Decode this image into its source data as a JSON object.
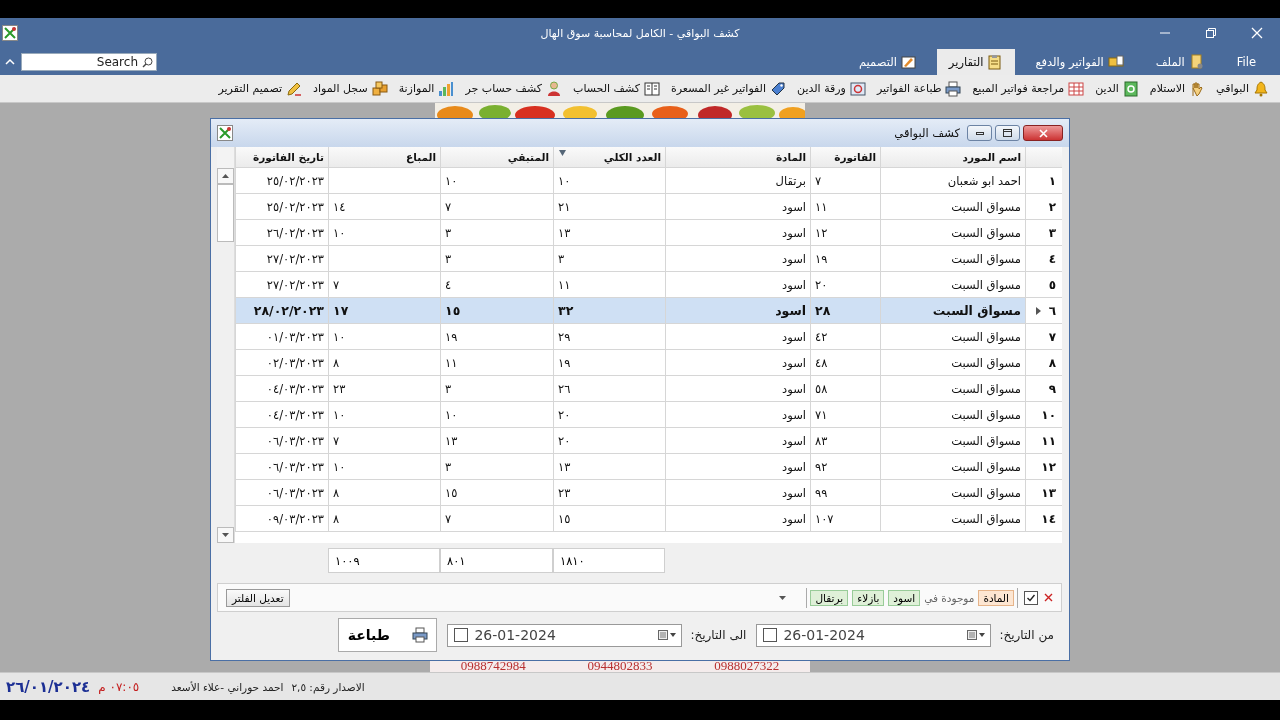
{
  "window": {
    "title": "كشف البواقي - الكامل لمحاسبة سوق الهال"
  },
  "ribbon": {
    "search": {
      "placeholder": "Search"
    },
    "tabs": [
      {
        "label": "File",
        "selected": false
      },
      {
        "label": "الملف",
        "selected": false
      },
      {
        "label": "الفواتير والدفع",
        "selected": false
      },
      {
        "label": "التقارير",
        "selected": true
      },
      {
        "label": "التصميم",
        "selected": false
      }
    ]
  },
  "toolbar": [
    "البواقي",
    "الاستلام",
    "الدين",
    "مراجعة فواتير المبيع",
    "طباعة الفواتير",
    "ورقة الدين",
    "الفواتير غير المسعرة",
    "كشف الحساب",
    "كشف حساب جر",
    "الموازنة",
    "سجل المواد",
    "تصميم التقرير"
  ],
  "background": {
    "phones": [
      "0988027322",
      "0944802833",
      "0988742984"
    ]
  },
  "report": {
    "title": "كشف البواقي",
    "columns": [
      {
        "label": "اسم المورد",
        "kind": "text",
        "filtered": false
      },
      {
        "label": "الفاتورة",
        "kind": "number",
        "filtered": false
      },
      {
        "label": "المادة",
        "kind": "text",
        "filtered": false
      },
      {
        "label": "العدد الكلي",
        "kind": "number",
        "filtered": true,
        "total": "١٨١٠"
      },
      {
        "label": "المتبقي",
        "kind": "number",
        "filtered": false,
        "total": "٨٠١"
      },
      {
        "label": "المباع",
        "kind": "number",
        "filtered": false,
        "total": "١٠٠٩"
      },
      {
        "label": "تاريخ الفاتورة",
        "kind": "date",
        "filtered": false
      }
    ],
    "rows": [
      {
        "number": "١",
        "selected": false,
        "cells": [
          "احمد ابو شعبان",
          "٧",
          "برتقال",
          "١٠",
          "١٠",
          null,
          "٢٥/٠٢/٢٠٢٣"
        ]
      },
      {
        "number": "٢",
        "selected": false,
        "cells": [
          "مسواق السبت",
          "١١",
          "اسود",
          "٢١",
          "٧",
          "١٤",
          "٢٥/٠٢/٢٠٢٣"
        ]
      },
      {
        "number": "٣",
        "selected": false,
        "cells": [
          "مسواق السبت",
          "١٢",
          "اسود",
          "١٣",
          "٣",
          "١٠",
          "٢٦/٠٢/٢٠٢٣"
        ]
      },
      {
        "number": "٤",
        "selected": false,
        "cells": [
          "مسواق السبت",
          "١٩",
          "اسود",
          "٣",
          "٣",
          null,
          "٢٧/٠٢/٢٠٢٣"
        ]
      },
      {
        "number": "٥",
        "selected": false,
        "cells": [
          "مسواق السبت",
          "٢٠",
          "اسود",
          "١١",
          "٤",
          "٧",
          "٢٧/٠٢/٢٠٢٣"
        ]
      },
      {
        "number": "٦",
        "selected": true,
        "cells": [
          "مسواق السبت",
          "٢٨",
          "اسود",
          "٣٢",
          "١٥",
          "١٧",
          "٢٨/٠٢/٢٠٢٣"
        ]
      },
      {
        "number": "٧",
        "selected": false,
        "cells": [
          "مسواق السبت",
          "٤٢",
          "اسود",
          "٢٩",
          "١٩",
          "١٠",
          "٠١/٠٣/٢٠٢٣"
        ]
      },
      {
        "number": "٨",
        "selected": false,
        "cells": [
          "مسواق السبت",
          "٤٨",
          "اسود",
          "١٩",
          "١١",
          "٨",
          "٠٢/٠٣/٢٠٢٣"
        ]
      },
      {
        "number": "٩",
        "selected": false,
        "cells": [
          "مسواق السبت",
          "٥٨",
          "اسود",
          "٢٦",
          "٣",
          "٢٣",
          "٠٤/٠٣/٢٠٢٣"
        ]
      },
      {
        "number": "١٠",
        "selected": false,
        "cells": [
          "مسواق السبت",
          "٧١",
          "اسود",
          "٢٠",
          "١٠",
          "١٠",
          "٠٤/٠٣/٢٠٢٣"
        ]
      },
      {
        "number": "١١",
        "selected": false,
        "cells": [
          "مسواق السبت",
          "٨٣",
          "اسود",
          "٢٠",
          "١٣",
          "٧",
          "٠٦/٠٣/٢٠٢٣"
        ]
      },
      {
        "number": "١٢",
        "selected": false,
        "cells": [
          "مسواق السبت",
          "٩٢",
          "اسود",
          "١٣",
          "٣",
          "١٠",
          "٠٦/٠٣/٢٠٢٣"
        ]
      },
      {
        "number": "١٣",
        "selected": false,
        "cells": [
          "مسواق السبت",
          "٩٩",
          "اسود",
          "٢٣",
          "١٥",
          "٨",
          "٠٦/٠٣/٢٠٢٣"
        ]
      },
      {
        "number": "١٤",
        "selected": false,
        "cells": [
          "مسواق السبت",
          "١٠٧",
          "اسود",
          "١٥",
          "٧",
          "٨",
          "٠٩/٠٣/٢٠٢٣"
        ]
      }
    ],
    "filter": {
      "enabled": true,
      "field": "المادة",
      "operator": "موجودة في",
      "values": [
        "اسود",
        "بازلاء",
        "برتقال"
      ],
      "edit_button": "تعديل الفلتر"
    },
    "from_date": {
      "label": "من التاريخ:",
      "checked": false,
      "value": "26-01-2024"
    },
    "to_date": {
      "label": "الى التاريخ:",
      "checked": false,
      "value": "26-01-2024"
    },
    "print_button": "طباعة"
  },
  "status_bar": {
    "date": "٢٦/٠١/٢٠٢٤",
    "time": "٠٧:٠٥ م",
    "authors": "احمد حوراني -علاء الأسعد",
    "version": "الاصدار رقم: ٢,٥"
  }
}
